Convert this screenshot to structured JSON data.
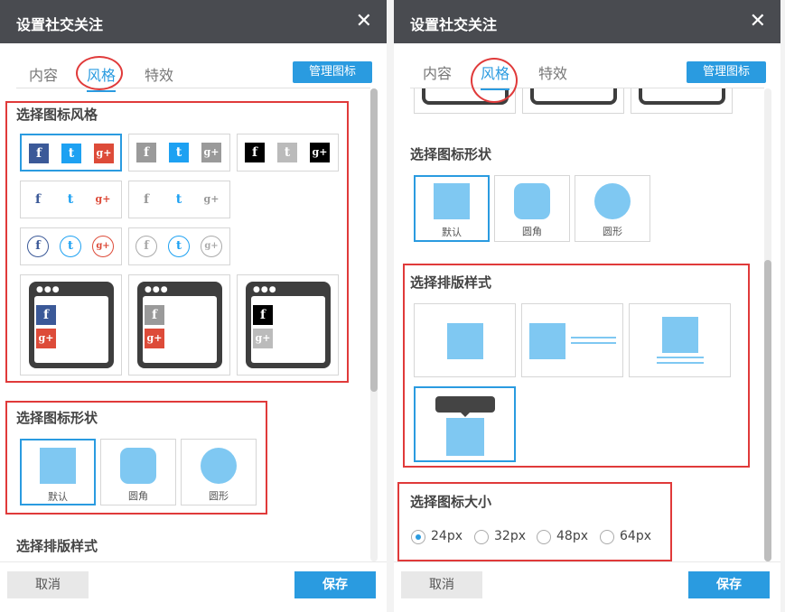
{
  "dialog": {
    "title": "设置社交关注",
    "close": "✕"
  },
  "tabs": {
    "content": "内容",
    "style": "风格",
    "effect": "特效"
  },
  "manage_button": "管理图标",
  "sections": {
    "icon_style": "选择图标风格",
    "icon_shape": "选择图标形状",
    "layout": "选择排版样式",
    "icon_size": "选择图标大小"
  },
  "shapes": {
    "default": "默认",
    "rounded": "圆角",
    "circle": "圆形"
  },
  "glyphs": {
    "facebook": "f",
    "twitter": "t",
    "google": "g+"
  },
  "sizes": [
    "24px",
    "32px",
    "48px",
    "64px"
  ],
  "selected_size": "24px",
  "footer": {
    "cancel": "取消",
    "save": "保存"
  },
  "colors": {
    "accent": "#2a9be0",
    "header": "#494b50",
    "highlight": "#e03a3a",
    "facebook": "#3b5998",
    "twitter": "#1da1f2",
    "google": "#dd4b39",
    "shape_fill": "#7fc8f2"
  }
}
